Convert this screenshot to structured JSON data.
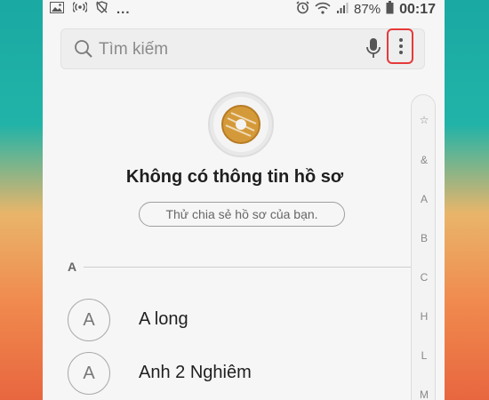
{
  "status_bar": {
    "dots": "...",
    "battery_percent": "87%",
    "time": "00:17"
  },
  "search": {
    "placeholder": "Tìm kiếm"
  },
  "profile": {
    "title": "Không có thông tin hồ sơ",
    "share_button": "Thử chia sẻ hồ sơ của bạn."
  },
  "section": {
    "letter": "A"
  },
  "contacts": [
    {
      "initial": "A",
      "name": "A long"
    },
    {
      "initial": "A",
      "name": "Anh 2 Nghiêm"
    }
  ],
  "index": [
    "☆",
    "&",
    "A",
    "B",
    "C",
    "H",
    "L",
    "M"
  ],
  "colors": {
    "highlight": "#e53a3a",
    "background": "#f6f6f6"
  }
}
